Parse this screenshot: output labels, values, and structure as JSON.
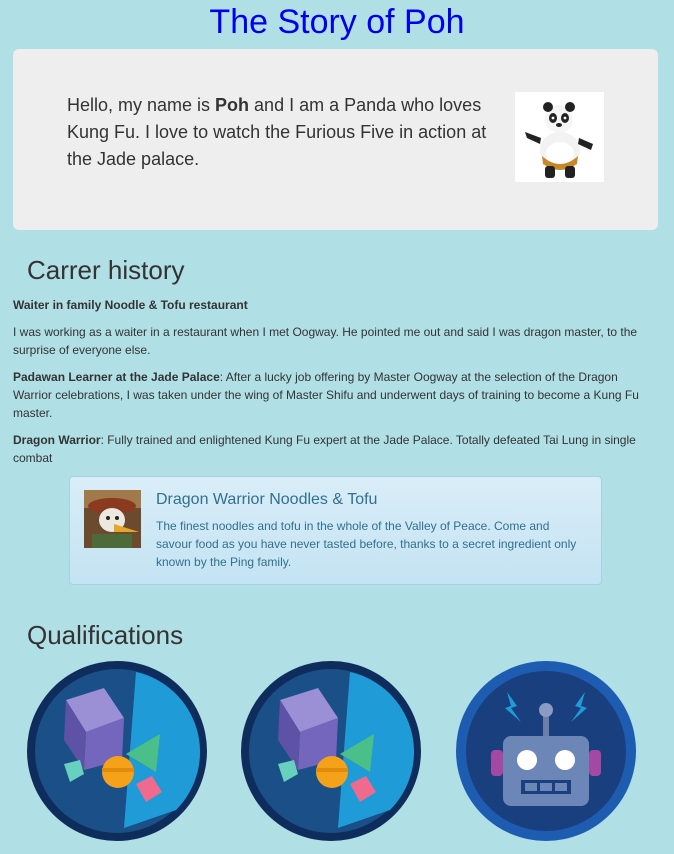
{
  "page": {
    "title": "The Story of Poh"
  },
  "intro": {
    "text_before": "Hello, my name is ",
    "name": "Poh",
    "text_after": " and I am a Panda who loves Kung Fu. I love to watch the Furious Five in action at the Jade palace."
  },
  "career": {
    "heading": "Carrer history",
    "job1_title": "Waiter in family Noodle & Tofu restaurant",
    "job1_text": "I was working as a waiter in a restaurant when I met Oogway. He pointed me out and said I was dragon master, to the surprise of everyone else.",
    "job2_title": "Padawan Learner at the Jade Palace",
    "job2_text": ": After a lucky job offering by Master Oogway at the selection of the Dragon Warrior celebrations, I was taken under the wing of Master Shifu and underwent days of training to become a Kung Fu master.",
    "job3_title": "Dragon Warrior",
    "job3_text": ": Fully trained and enlightened Kung Fu expert at the Jade Palace. Totally defeated Tai Lung in single combat"
  },
  "ad": {
    "title": "Dragon Warrior Noodles & Tofu",
    "body": "The finest noodles and tofu in the whole of the Valley of Peace. Come and savour food as you have never tasted before, thanks to a secret ingredient only known by the Ping family."
  },
  "qualifications": {
    "heading": "Qualifications"
  },
  "colors": {
    "background": "#b0dfe5",
    "title": "#0000ee",
    "ad_text": "#31708f"
  },
  "icons": [
    "panda-image",
    "goose-image",
    "gems-badge-icon",
    "robot-badge-icon"
  ]
}
